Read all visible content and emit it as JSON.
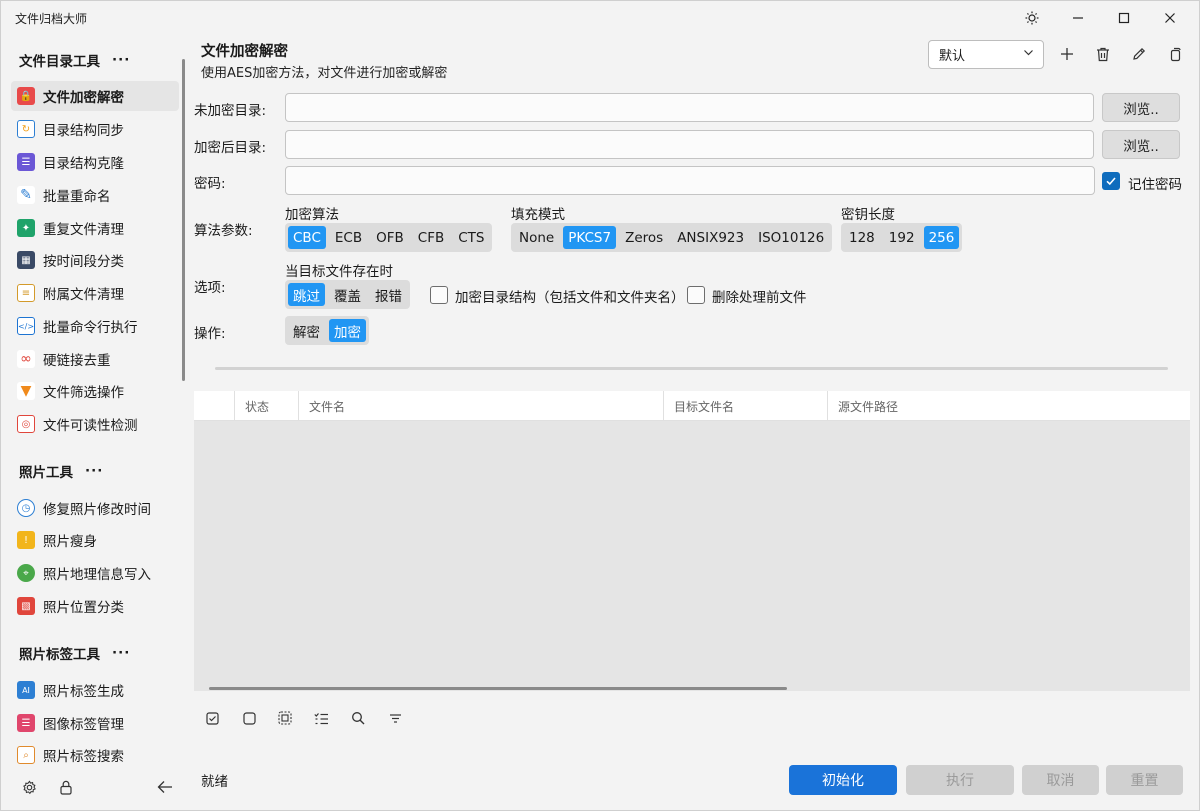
{
  "window": {
    "title": "文件归档大师"
  },
  "sidebar": {
    "groups": [
      {
        "title": "文件目录工具",
        "more": "···",
        "items": [
          {
            "label": "文件加密解密",
            "icon": "lock-file-icon",
            "color": "#e84a4a",
            "active": true
          },
          {
            "label": "目录结构同步",
            "icon": "sync-folder-icon",
            "color": "#f2a01b"
          },
          {
            "label": "目录结构克隆",
            "icon": "list-clone-icon",
            "color": "#6b57d6"
          },
          {
            "label": "批量重命名",
            "icon": "pencil-rename-icon",
            "color": "#2d7fd3"
          },
          {
            "label": "重复文件清理",
            "icon": "broom-clean-icon",
            "color": "#1fa36a"
          },
          {
            "label": "按时间段分类",
            "icon": "calendar-icon",
            "color": "#3a4a66"
          },
          {
            "label": "附属文件清理",
            "icon": "document-icon",
            "color": "#d39a2a"
          },
          {
            "label": "批量命令行执行",
            "icon": "terminal-code-icon",
            "color": "#1d74d2"
          },
          {
            "label": "硬链接去重",
            "icon": "link-icon",
            "color": "#e0463c"
          },
          {
            "label": "文件筛选操作",
            "icon": "funnel-icon",
            "color": "#f08a1c"
          },
          {
            "label": "文件可读性检测",
            "icon": "glasses-check-icon",
            "color": "#e0463c"
          }
        ]
      },
      {
        "title": "照片工具",
        "more": "···",
        "items": [
          {
            "label": "修复照片修改时间",
            "icon": "clock-icon",
            "color": "#2d7fd3"
          },
          {
            "label": "照片瘦身",
            "icon": "photo-compress-icon",
            "color": "#f2b51b"
          },
          {
            "label": "照片地理信息写入",
            "icon": "map-pin-icon",
            "color": "#4aa84a"
          },
          {
            "label": "照片位置分类",
            "icon": "map-icon",
            "color": "#e0463c"
          }
        ]
      },
      {
        "title": "照片标签工具",
        "more": "···",
        "items": [
          {
            "label": "照片标签生成",
            "icon": "ai-tag-icon",
            "color": "#2d7fd3"
          },
          {
            "label": "图像标签管理",
            "icon": "tag-manage-icon",
            "color": "#e0466c"
          },
          {
            "label": "照片标签搜索",
            "icon": "tag-search-icon",
            "color": "#e08a2c"
          }
        ]
      }
    ]
  },
  "header": {
    "title": "文件加密解密",
    "subtitle": "使用AES加密方法，对文件进行加密或解密",
    "preset": "默认"
  },
  "form": {
    "source_dir_label": "未加密目录:",
    "target_dir_label": "加密后目录:",
    "password_label": "密码:",
    "source_dir_value": "",
    "target_dir_value": "",
    "password_value": "",
    "browse_label": "浏览..",
    "remember_password": "记住密码",
    "algo_params_label": "算法参数:",
    "options_label": "选项:",
    "operation_label": "操作:",
    "cipher_mode": {
      "caption": "加密算法",
      "options": [
        "CBC",
        "ECB",
        "OFB",
        "CFB",
        "CTS"
      ],
      "selected": "CBC"
    },
    "padding_mode": {
      "caption": "填充模式",
      "options": [
        "None",
        "PKCS7",
        "Zeros",
        "ANSIX923",
        "ISO10126"
      ],
      "selected": "PKCS7"
    },
    "key_length": {
      "caption": "密钥长度",
      "options": [
        "128",
        "192",
        "256"
      ],
      "selected": "256"
    },
    "exists_policy": {
      "caption": "当目标文件存在时",
      "options": [
        "跳过",
        "覆盖",
        "报错"
      ],
      "selected": "跳过"
    },
    "encrypt_structure": "加密目录结构（包括文件和文件夹名）",
    "delete_source": "删除处理前文件",
    "operation": {
      "options": [
        "解密",
        "加密"
      ],
      "selected": "加密"
    }
  },
  "grid": {
    "columns": [
      "状态",
      "文件名",
      "目标文件名",
      "源文件路径"
    ]
  },
  "status": {
    "text": "就绪",
    "buttons": {
      "init": "初始化",
      "run": "执行",
      "cancel": "取消",
      "reset": "重置"
    }
  },
  "colors": {
    "accent": "#2196f3",
    "primary_button": "#1a73d9",
    "checkbox": "#0f6cbd"
  }
}
